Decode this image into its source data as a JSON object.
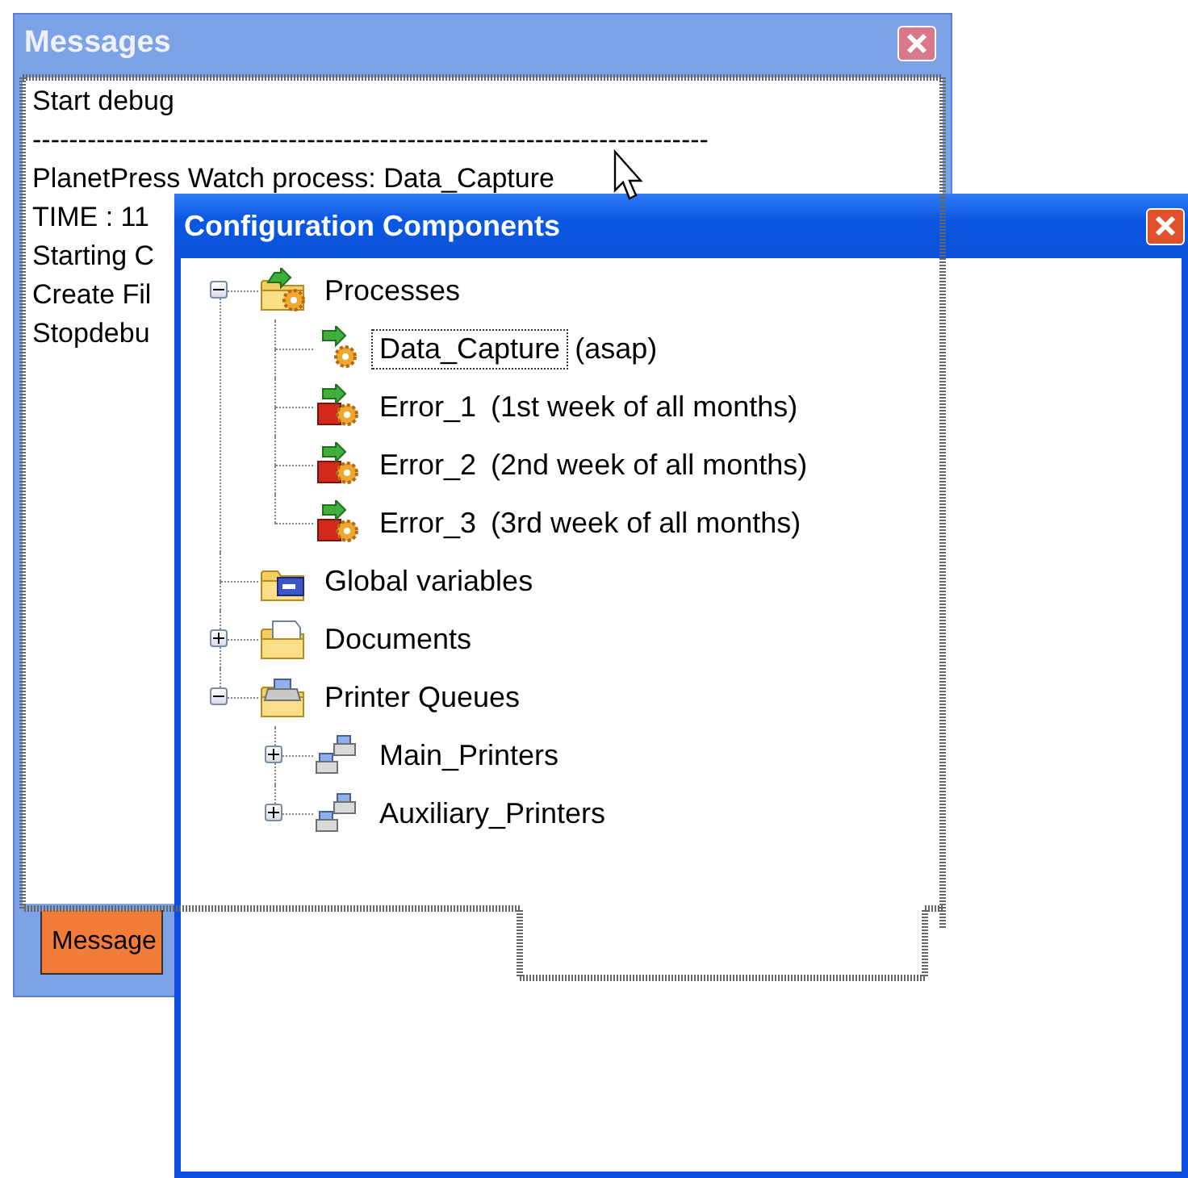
{
  "messages_window": {
    "title": "Messages",
    "lines": [
      "Start debug",
      "--------------------------------------------------------------------------",
      "PlanetPress Watch process: Data_Capture",
      "TIME : 11",
      "Starting C",
      "Create Fil",
      "Stopdebu"
    ],
    "tabs": [
      {
        "label": "Message",
        "selected": true
      }
    ]
  },
  "config_window": {
    "title": "Configuration Components",
    "tree": [
      {
        "kind": "process-folder",
        "label": "Processes",
        "expanded": true,
        "selected": false,
        "children": [
          {
            "kind": "process",
            "label": "Data_Capture",
            "note": "(asap)",
            "selected": true
          },
          {
            "kind": "process-error",
            "label": "Error_1",
            "note": "(1st week of all months)",
            "selected": false
          },
          {
            "kind": "process-error",
            "label": "Error_2",
            "note": "(2nd week of all months)",
            "selected": false
          },
          {
            "kind": "process-error",
            "label": "Error_3",
            "note": "(3rd week of all months)",
            "selected": false
          }
        ]
      },
      {
        "kind": "global-variables",
        "label": "Global variables",
        "selected": false
      },
      {
        "kind": "documents",
        "label": "Documents",
        "expanded": false,
        "selected": false
      },
      {
        "kind": "printer-folder",
        "label": "Printer Queues",
        "expanded": true,
        "selected": false,
        "children": [
          {
            "kind": "printer-group",
            "label": "Main_Printers",
            "expanded": false,
            "selected": false
          },
          {
            "kind": "printer-group",
            "label": "Auxiliary_Printers",
            "expanded": false,
            "selected": false
          }
        ]
      }
    ]
  }
}
